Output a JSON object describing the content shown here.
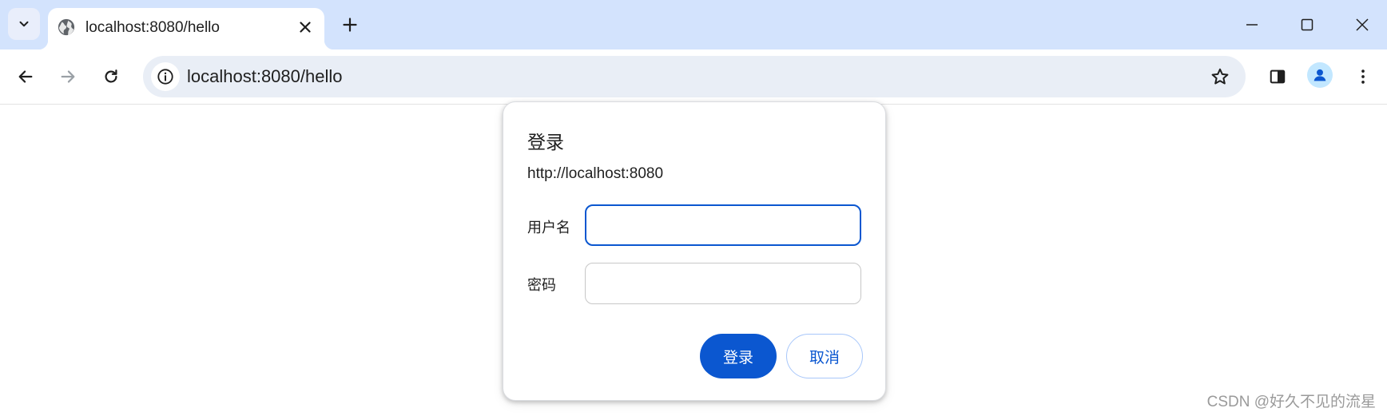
{
  "tab": {
    "title": "localhost:8080/hello"
  },
  "omnibox": {
    "url": "localhost:8080/hello"
  },
  "dialog": {
    "title": "登录",
    "origin": "http://localhost:8080",
    "username_label": "用户名",
    "password_label": "密码",
    "username_value": "",
    "password_value": "",
    "login_button": "登录",
    "cancel_button": "取消"
  },
  "watermark": "CSDN @好久不见的流星",
  "colors": {
    "tabstrip_bg": "#d3e3fd",
    "accent": "#0b57d0",
    "omnibox_bg": "#e9eef6"
  },
  "icons": [
    "tab-search-icon",
    "globe-icon",
    "close-icon",
    "plus-icon",
    "minimize-icon",
    "maximize-icon",
    "window-close-icon",
    "back-icon",
    "forward-icon",
    "reload-icon",
    "info-icon",
    "star-icon",
    "side-panel-icon",
    "profile-icon",
    "kebab-menu-icon"
  ]
}
